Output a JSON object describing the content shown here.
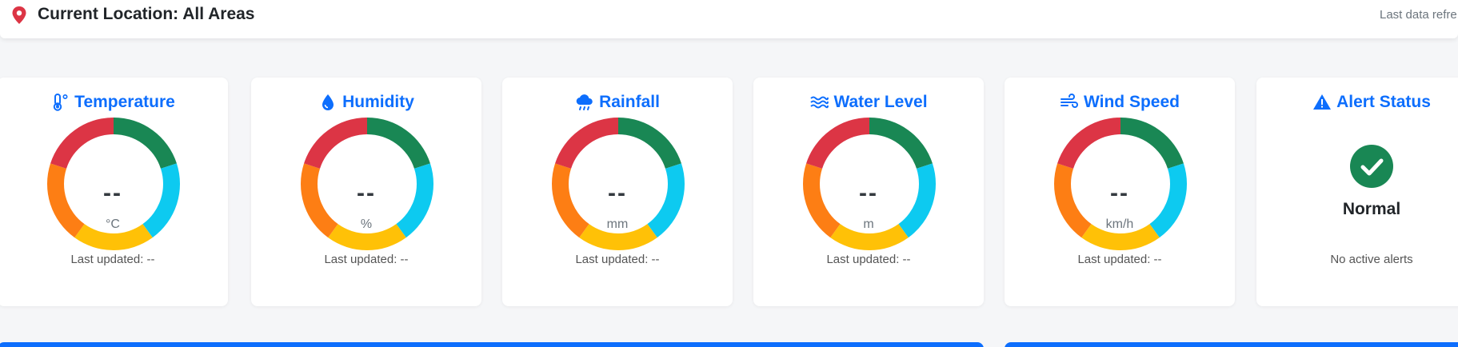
{
  "header": {
    "location_label": "Current Location: All Areas",
    "refresh_text": "Last data refre"
  },
  "colors": {
    "accent": "#0d6efd",
    "pin": "#dc3545",
    "gauge_segments": [
      "#198754",
      "#0dcaf0",
      "#ffc107",
      "#fd7e14",
      "#dc3545"
    ]
  },
  "cards": [
    {
      "title": "Temperature",
      "icon": "thermometer-icon",
      "value": "--",
      "unit": "°C",
      "updated": "Last updated: --"
    },
    {
      "title": "Humidity",
      "icon": "droplet-icon",
      "value": "--",
      "unit": "%",
      "updated": "Last updated: --"
    },
    {
      "title": "Rainfall",
      "icon": "cloud-rain-icon",
      "value": "--",
      "unit": "mm",
      "updated": "Last updated: --"
    },
    {
      "title": "Water Level",
      "icon": "water-waves-icon",
      "value": "--",
      "unit": "m",
      "updated": "Last updated: --"
    },
    {
      "title": "Wind Speed",
      "icon": "wind-icon",
      "value": "--",
      "unit": "km/h",
      "updated": "Last updated: --"
    }
  ],
  "alert": {
    "title": "Alert Status",
    "icon": "warning-triangle-icon",
    "status": "Normal",
    "message": "No active alerts"
  }
}
